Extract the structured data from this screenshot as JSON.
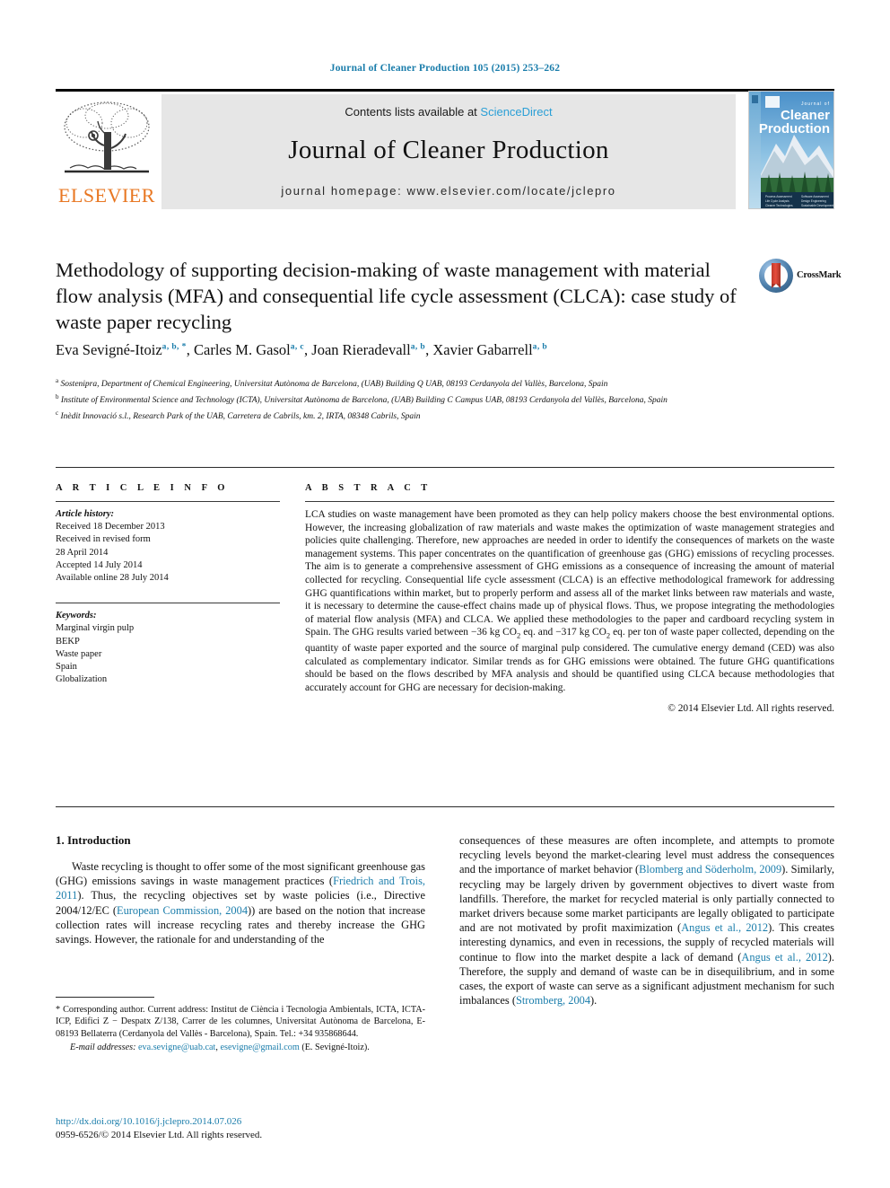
{
  "running_head": "Journal of Cleaner Production 105 (2015) 253–262",
  "banner": {
    "contents_prefix": "Contents lists available at ",
    "sciencedirect": "ScienceDirect",
    "journal_name": "Journal of Cleaner Production",
    "homepage": "journal homepage: www.elsevier.com/locate/jclepro",
    "publisher_logo_text": "ELSEVIER",
    "cover_title_line1": "Journal of",
    "cover_title_line2": "Cleaner",
    "cover_title_line3": "Production"
  },
  "crossmark": {
    "label": "CrossMark"
  },
  "article": {
    "title": "Methodology of supporting decision-making of waste management with material flow analysis (MFA) and consequential life cycle assessment (CLCA): case study of waste paper recycling",
    "authors_plain": "Eva Sevigné-Itoiz a, b, *, Carles M. Gasol a, c, Joan Rieradevall a, b, Xavier Gabarrell a, b",
    "authors": [
      {
        "name": "Eva Sevigné-Itoiz",
        "marks": "a, b, *"
      },
      {
        "name": "Carles M. Gasol",
        "marks": "a, c"
      },
      {
        "name": "Joan Rieradevall",
        "marks": "a, b"
      },
      {
        "name": "Xavier Gabarrell",
        "marks": "a, b"
      }
    ],
    "affiliations": [
      {
        "mark": "a",
        "text": "Sostenipra, Department of Chemical Engineering, Universitat Autònoma de Barcelona, (UAB) Building Q UAB, 08193 Cerdanyola del Vallès, Barcelona, Spain"
      },
      {
        "mark": "b",
        "text": "Institute of Environmental Science and Technology (ICTA), Universitat Autònoma de Barcelona, (UAB) Building C Campus UAB, 08193 Cerdanyola del Vallès, Barcelona, Spain"
      },
      {
        "mark": "c",
        "text": "Inèdit Innovació s.l., Research Park of the UAB, Carretera de Cabrils, km. 2, IRTA, 08348 Cabrils, Spain"
      }
    ]
  },
  "article_info": {
    "heading": "A R T I C L E   I N F O",
    "history_label": "Article history:",
    "history": [
      "Received 18 December 2013",
      "Received in revised form",
      "28 April 2014",
      "Accepted 14 July 2014",
      "Available online 28 July 2014"
    ],
    "keywords_label": "Keywords:",
    "keywords": [
      "Marginal virgin pulp",
      "BEKP",
      "Waste paper",
      "Spain",
      "Globalization"
    ]
  },
  "abstract": {
    "heading": "A B S T R A C T",
    "part1": "LCA studies on waste management have been promoted as they can help policy makers choose the best environmental options. However, the increasing globalization of raw materials and waste makes the optimization of waste management strategies and policies quite challenging. Therefore, new approaches are needed in order to identify the consequences of markets on the waste management systems. This paper concentrates on the quantification of greenhouse gas (GHG) emissions of recycling processes. The aim is to generate a comprehensive assessment of GHG emissions as a consequence of increasing the amount of material collected for recycling. Consequential life cycle assessment (CLCA) is an effective methodological framework for addressing GHG quantifications within market, but to properly perform and assess all of the market links between raw materials and waste, it is necessary to determine the cause-effect chains made up of physical flows. Thus, we propose integrating the methodologies of material flow analysis (MFA) and CLCA. We applied these methodologies to the paper and cardboard recycling system in Spain. The GHG results varied between ",
    "val1": "−36 kg CO",
    "val1_sub": "2",
    "val1_tail": " eq. and ",
    "val2": "−317 kg CO",
    "val2_sub": "2",
    "val2_tail": " eq. per ton of waste paper collected, depending on the quantity of waste paper exported and the source of marginal pulp considered. The cumulative energy demand (CED) was also calculated as complementary indicator. Similar trends as for GHG emissions were obtained. The future GHG quantifications should be based on the flows described by MFA analysis and should be quantified using CLCA because methodologies that accurately account for GHG are necessary for decision-making.",
    "copyright": "© 2014 Elsevier Ltd. All rights reserved."
  },
  "body": {
    "section_heading": "1. Introduction",
    "left_p1_a": "Waste recycling is thought to offer some of the most significant greenhouse gas (GHG) emissions savings in waste management practices (",
    "left_ref1": "Friedrich and Trois, 2011",
    "left_p1_b": "). Thus, the recycling objectives set by waste policies (i.e., Directive 2004/12/EC (",
    "left_ref2": "European Commission, 2004",
    "left_p1_c": ")) are based on the notion that increase collection rates will increase recycling rates and thereby increase the GHG savings. However, the rationale for and understanding of the",
    "right_p1_a": "consequences of these measures are often incomplete, and attempts to promote recycling levels beyond the market-clearing level must address the consequences and the importance of market behavior (",
    "right_ref1": "Blomberg and Söderholm, 2009",
    "right_p1_b": "). Similarly, recycling may be largely driven by government objectives to divert waste from landfills. Therefore, the market for recycled material is only partially connected to market drivers because some market participants are legally obligated to participate and are not motivated by profit maximization (",
    "right_ref2": "Angus et al., 2012",
    "right_p1_c": "). This creates interesting dynamics, and even in recessions, the supply of recycled materials will continue to flow into the market despite a lack of demand (",
    "right_ref3": "Angus et al., 2012",
    "right_p1_d": "). Therefore, the supply and demand of waste can be in disequilibrium, and in some cases, the export of waste can serve as a significant adjustment mechanism for such imbalances (",
    "right_ref4": "Stromberg, 2004",
    "right_p1_e": ")."
  },
  "footnotes": {
    "corresponding_mark": "*",
    "corresponding": " Corresponding author. Current address: Institut de Ciència i Tecnologia Ambientals, ICTA, ICTA-ICP, Edifici Z − Despatx Z/138, Carrer de les columnes, Universitat Autònoma de Barcelona, E-08193 Bellaterra (Cerdanyola del Vallès - Barcelona), Spain. Tel.: +34 935868644.",
    "email_label": "E-mail addresses:",
    "email1": "eva.sevigne@uab.cat",
    "email_sep": ", ",
    "email2": "esevigne@gmail.com",
    "email_tail": " (E. Sevigné-Itoiz).",
    "doi": "http://dx.doi.org/10.1016/j.jclepro.2014.07.026",
    "issn": "0959-6526/© 2014 Elsevier Ltd. All rights reserved."
  },
  "colors": {
    "link_blue": "#1a7dab",
    "sciencedirect_blue": "#2a9fd6",
    "elsevier_orange": "#e87722",
    "banner_grey": "#e6e6e6"
  }
}
